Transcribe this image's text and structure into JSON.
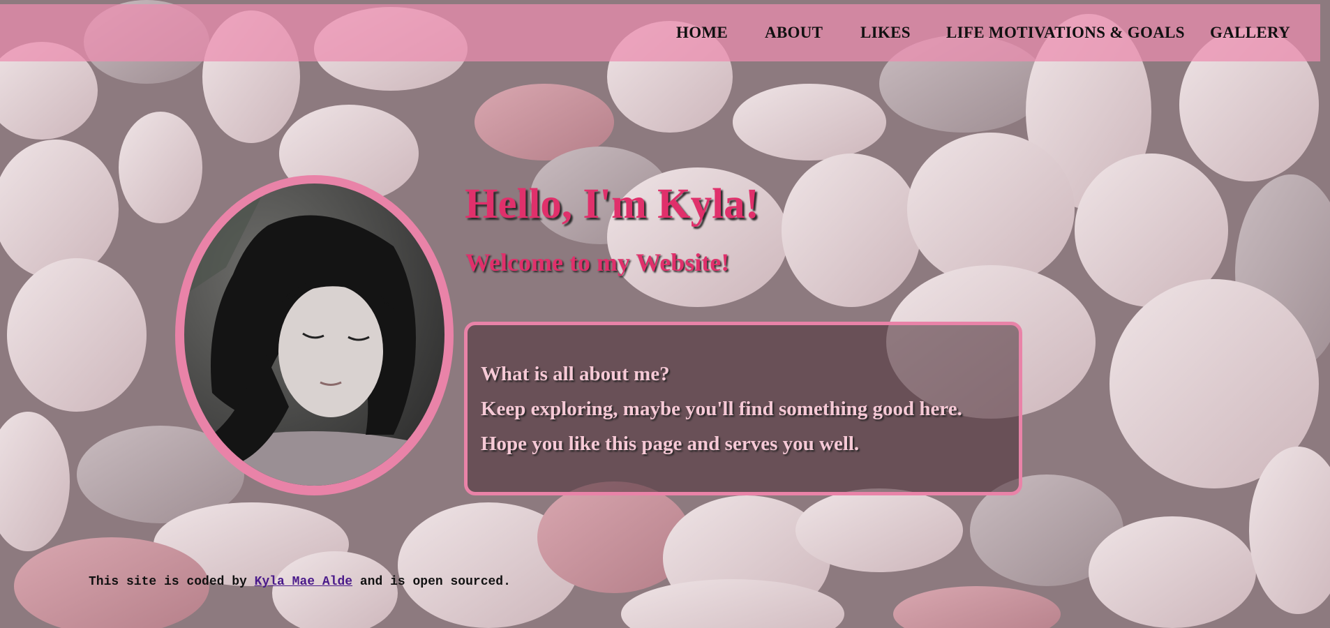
{
  "nav": {
    "items": [
      {
        "label": "HOME"
      },
      {
        "label": "ABOUT"
      },
      {
        "label": "LIKES"
      },
      {
        "label": "LIFE MOTIVATIONS & GOALS"
      },
      {
        "label": "GALLERY"
      }
    ]
  },
  "hero": {
    "title": "Hello, I'm Kyla!",
    "subtitle": "Welcome to my Website!"
  },
  "about": {
    "lines": [
      "What is all about me?",
      "Keep exploring, maybe you'll find something good here.",
      "Hope you like this page and serves you well."
    ]
  },
  "footer": {
    "prefix": "This site is coded by ",
    "link_text": "Kyla Mae Alde",
    "suffix": " and is open sourced."
  },
  "colors": {
    "nav_bg": "#eb8caf",
    "accent": "#e0306b",
    "frame": "#e983a8",
    "about_text": "#f6c9d6"
  },
  "background": {
    "icon": "pebbles-background"
  },
  "profile_photo": {
    "icon": "profile-photo"
  }
}
